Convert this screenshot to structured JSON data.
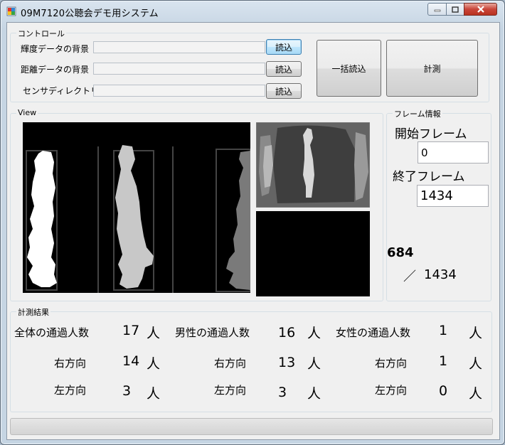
{
  "window": {
    "title": "09M7120公聴会デモ用システム"
  },
  "control": {
    "group_label": "コントロール",
    "rows": [
      {
        "label": "輝度データの背景",
        "path": "",
        "button": "読込"
      },
      {
        "label": "距離データの背景",
        "path": "",
        "button": "読込"
      },
      {
        "label": "センサディレクトリ",
        "path": "",
        "button": "読込"
      }
    ],
    "batch_button": "一括読込",
    "measure_button": "計測"
  },
  "view": {
    "group_label": "View"
  },
  "frame_info": {
    "group_label": "フレーム情報",
    "start_label": "開始フレーム",
    "start_value": "0",
    "end_label": "終了フレーム",
    "end_value": "1434",
    "current": "684",
    "separator": "／",
    "total": "1434"
  },
  "results": {
    "group_label": "計測結果",
    "unit": "人",
    "columns": [
      {
        "title": "全体の通過人数",
        "total": "17",
        "right_label": "右方向",
        "right": "14",
        "left_label": "左方向",
        "left": "3"
      },
      {
        "title": "男性の通過人数",
        "total": "16",
        "right_label": "右方向",
        "right": "13",
        "left_label": "左方向",
        "left": "3"
      },
      {
        "title": "女性の通過人数",
        "total": "1",
        "right_label": "右方向",
        "right": "1",
        "left_label": "左方向",
        "left": "0"
      }
    ]
  },
  "progress": {
    "value": 0
  }
}
